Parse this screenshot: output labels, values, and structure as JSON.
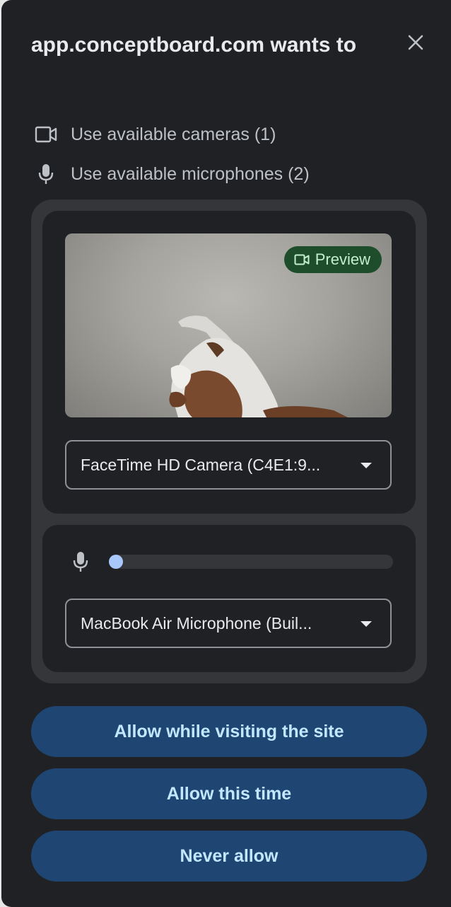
{
  "dialog": {
    "title_host": "app.conceptboard.com",
    "title_suffix": "wants to",
    "close_icon": "close-icon"
  },
  "permissions": [
    {
      "icon": "camera-icon",
      "label": "Use available cameras (1)"
    },
    {
      "icon": "microphone-icon",
      "label": "Use available microphones (2)"
    }
  ],
  "camera": {
    "preview_label": "Preview",
    "preview_icon": "video-camera-icon",
    "selected_device": "FaceTime HD Camera (C4E1:9..."
  },
  "microphone": {
    "icon": "microphone-icon",
    "level": 0.05,
    "selected_device": "MacBook Air Microphone (Buil..."
  },
  "buttons": {
    "allow_site": "Allow while visiting the site",
    "allow_once": "Allow this time",
    "never": "Never allow"
  },
  "colors": {
    "background": "#202124",
    "panel": "#35363a",
    "button": "#1f4673",
    "button_text": "#c2e7ff",
    "preview_badge": "#1e4d2b",
    "level_indicator": "#a8c7fa"
  }
}
